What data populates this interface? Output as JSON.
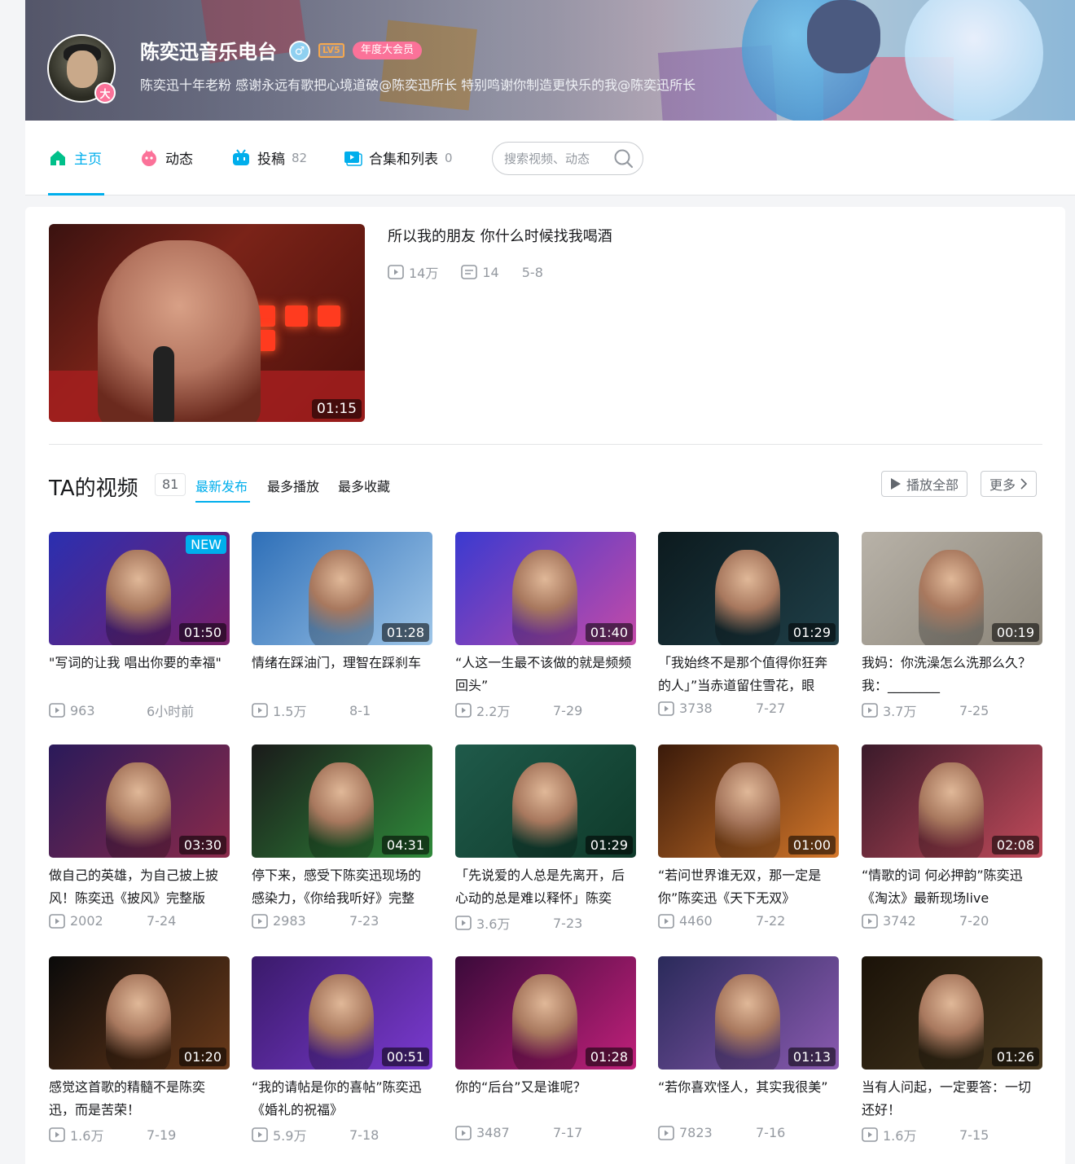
{
  "profile": {
    "name": "陈奕迅音乐电台",
    "level": "LV5",
    "vip": "年度大会员",
    "sign": "陈奕迅十年老粉 感谢永远有歌把心境道破@陈奕迅所长 特别鸣谢你制造更快乐的我@陈奕迅所长",
    "avatar_badge": "大"
  },
  "nav": {
    "home": "主页",
    "dynamic": "动态",
    "uploads": "投稿",
    "uploads_count": "82",
    "collections": "合集和列表",
    "collections_count": "0",
    "search_placeholder": "搜索视频、动态"
  },
  "featured": {
    "title": "所以我的朋友 你什么时候找我喝酒",
    "plays": "14万",
    "comments": "14",
    "date": "5-8",
    "duration": "01:15"
  },
  "videos_section": {
    "title": "TA的视频",
    "count": "81",
    "sort_tabs": [
      "最新发布",
      "最多播放",
      "最多收藏"
    ],
    "play_all": "播放全部",
    "more": "更多"
  },
  "videos": [
    {
      "title": "\"写词的让我 唱出你要的幸福\"",
      "plays": "963",
      "date": "6小时前",
      "duration": "01:50",
      "new": "NEW"
    },
    {
      "title": "情绪在踩油门，理智在踩刹车",
      "plays": "1.5万",
      "date": "8-1",
      "duration": "01:28"
    },
    {
      "title": "“人这一生最不该做的就是频频回头”",
      "plays": "2.2万",
      "date": "7-29",
      "duration": "01:40"
    },
    {
      "title": "「我始终不是那个值得你狂奔的人」”当赤道留住雪花，眼",
      "plays": "3738",
      "date": "7-27",
      "duration": "01:29"
    },
    {
      "title": "我妈：你洗澡怎么洗那么久？我：________",
      "plays": "3.7万",
      "date": "7-25",
      "duration": "00:19"
    },
    {
      "title": "做自己的英雄，为自己披上披风！陈奕迅《披风》完整版",
      "plays": "2002",
      "date": "7-24",
      "duration": "03:30"
    },
    {
      "title": "停下来，感受下陈奕迅现场的感染力，《你给我听好》完整",
      "plays": "2983",
      "date": "7-23",
      "duration": "04:31"
    },
    {
      "title": "「先说爱的人总是先离开，后心动的总是难以释怀」陈奕",
      "plays": "3.6万",
      "date": "7-23",
      "duration": "01:29"
    },
    {
      "title": "“若问世界谁无双，那一定是你”陈奕迅《天下无双》",
      "plays": "4460",
      "date": "7-22",
      "duration": "01:00"
    },
    {
      "title": "“情歌的词 何必押韵”陈奕迅《淘汰》最新现场live",
      "plays": "3742",
      "date": "7-20",
      "duration": "02:08"
    },
    {
      "title": "感觉这首歌的精髓不是陈奕迅，而是苦荣！",
      "plays": "1.6万",
      "date": "7-19",
      "duration": "01:20"
    },
    {
      "title": "“我的请帖是你的喜帖”陈奕迅《婚礼的祝福》",
      "plays": "5.9万",
      "date": "7-18",
      "duration": "00:51"
    },
    {
      "title": "你的“后台”又是谁呢？",
      "plays": "3487",
      "date": "7-17",
      "duration": "01:28"
    },
    {
      "title": "“若你喜欢怪人，其实我很美”",
      "plays": "7823",
      "date": "7-16",
      "duration": "01:13"
    },
    {
      "title": "当有人问起，一定要答：一切还好！",
      "plays": "1.6万",
      "date": "7-15",
      "duration": "01:26"
    }
  ],
  "thumb_colors": [
    [
      "#2a2fb0",
      "#7a1f6a"
    ],
    [
      "#2e6fb8",
      "#9fc6e8"
    ],
    [
      "#3a3ad0",
      "#c44aa8"
    ],
    [
      "#0c1a1e",
      "#1f3f48"
    ],
    [
      "#b8b2a8",
      "#8a8478"
    ],
    [
      "#2a1a5a",
      "#8a2a4a"
    ],
    [
      "#1a1a1a",
      "#2f8a3a"
    ],
    [
      "#1f5a4a",
      "#0f3a2a"
    ],
    [
      "#3a1a0a",
      "#d4772a"
    ],
    [
      "#3a1a2a",
      "#c04a5a"
    ],
    [
      "#0a0a0a",
      "#6a3a1a"
    ],
    [
      "#3a1a6a",
      "#7a3ad0"
    ],
    [
      "#3a0a3a",
      "#c0207a"
    ],
    [
      "#2a2a5a",
      "#8a5ab0"
    ],
    [
      "#1a1208",
      "#4a3a20"
    ]
  ]
}
